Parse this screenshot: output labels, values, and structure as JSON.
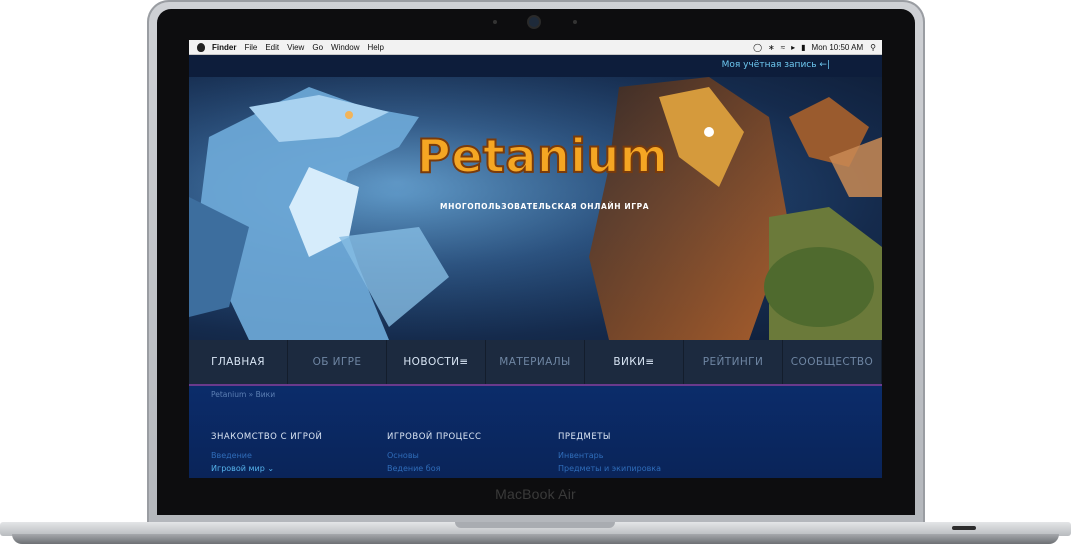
{
  "device": {
    "brand": "MacBook Air"
  },
  "menubar": {
    "items": [
      "Finder",
      "File",
      "Edit",
      "View",
      "Go",
      "Window",
      "Help"
    ],
    "clock": "Mon 10:50 AM"
  },
  "site": {
    "account_label": "Моя учётная запись",
    "logo_text": "Petanium",
    "tagline": "МНОГОПОЛЬЗОВАТЕЛЬСКАЯ ОНЛАЙН ИГРА",
    "nav": [
      "ГЛАВНАЯ",
      "ОБ ИГРЕ",
      "НОВОСТИ",
      "МАТЕРИАЛЫ",
      "ВИКИ",
      "РЕЙТИНГИ",
      "СООБЩЕСТВО"
    ],
    "breadcrumb": "Petanium » Вики",
    "columns": [
      {
        "title": "ЗНАКОМСТВО С ИГРОЙ",
        "links": [
          "Введение",
          "Игровой мир"
        ]
      },
      {
        "title": "ИГРОВОЙ ПРОЦЕСС",
        "links": [
          "Основы",
          "Ведение боя"
        ]
      },
      {
        "title": "ПРЕДМЕТЫ",
        "links": [
          "Инвентарь",
          "Предметы и экипировка"
        ]
      }
    ]
  },
  "colors": {
    "menu_bg": "#1c2a3f",
    "accent": "#6ec8f0",
    "content_bg": "#0b2c6a",
    "logo": "#f5a623"
  }
}
